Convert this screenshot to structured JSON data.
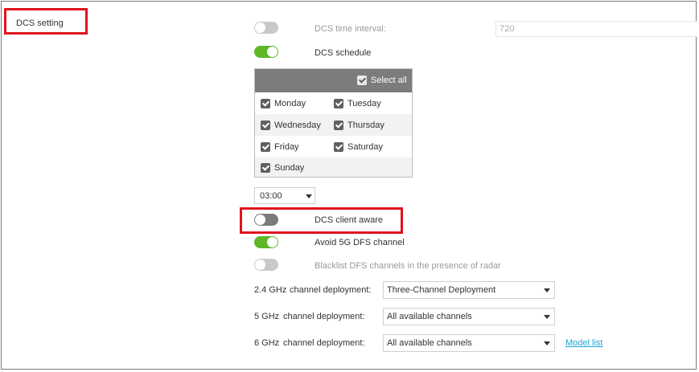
{
  "section": {
    "label": "DCS setting"
  },
  "time_interval": {
    "label": "DCS time interval:",
    "value": "720",
    "enabled": false
  },
  "schedule": {
    "label": "DCS schedule",
    "enabled": true,
    "select_all_label": "Select all",
    "days": [
      "Monday",
      "Tuesday",
      "Wednesday",
      "Thursday",
      "Friday",
      "Saturday",
      "Sunday"
    ]
  },
  "time_select": {
    "value": "03:00"
  },
  "client_aware": {
    "label": "DCS client aware",
    "enabled": false
  },
  "avoid_dfs": {
    "label": "Avoid 5G DFS channel",
    "enabled": true
  },
  "blacklist_dfs": {
    "label": "Blacklist DFS channels in the presence of radar",
    "enabled": false
  },
  "deployment": [
    {
      "band": "2.4 GHz",
      "label": "channel deployment:",
      "value": "Three-Channel Deployment"
    },
    {
      "band": "5 GHz",
      "label": "channel deployment:",
      "value": "All available channels"
    },
    {
      "band": "6 GHz",
      "label": "channel deployment:",
      "value": "All available channels"
    }
  ],
  "model_list_link": "Model list",
  "colors": {
    "highlight": "#e0141e",
    "toggle_on": "#5fb728",
    "link": "#1aa3d8"
  }
}
